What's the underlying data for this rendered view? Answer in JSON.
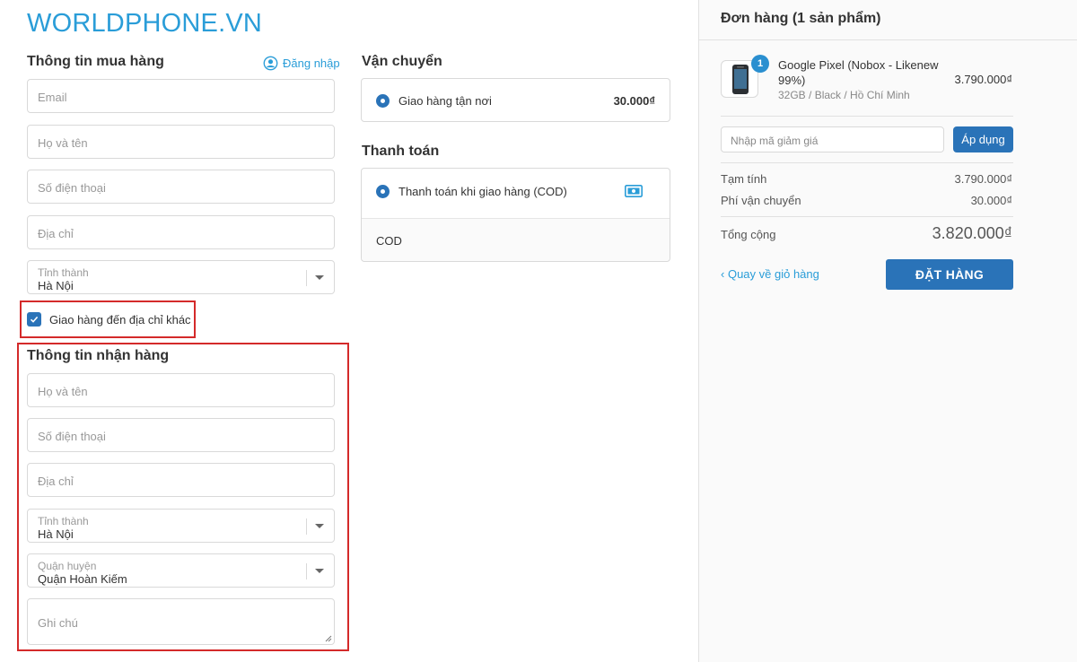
{
  "brand": {
    "logo_text": "WORLDPHONE.VN"
  },
  "buyer": {
    "title": "Thông tin mua hàng",
    "login_label": "Đăng nhập",
    "email_placeholder": "Email",
    "name_placeholder": "Họ và tên",
    "phone_placeholder": "Số điện thoại",
    "address_placeholder": "Địa chỉ",
    "province_label": "Tỉnh thành",
    "province_value": "Hà Nội"
  },
  "ship_other": {
    "label": "Giao hàng đến địa chỉ khác",
    "checked": true
  },
  "receiver": {
    "title": "Thông tin nhận hàng",
    "name_placeholder": "Họ và tên",
    "phone_placeholder": "Số điện thoại",
    "address_placeholder": "Địa chỉ",
    "province_label": "Tỉnh thành",
    "province_value": "Hà Nội",
    "district_label": "Quận huyện",
    "district_value": "Quận Hoàn Kiếm",
    "note_placeholder": "Ghi chú"
  },
  "shipping": {
    "title": "Vận chuyển",
    "option_label": "Giao hàng tận nơi",
    "option_price": "30.000₫"
  },
  "payment": {
    "title": "Thanh toán",
    "option_label": "Thanh toán khi giao hàng (COD)",
    "detail": "COD"
  },
  "order": {
    "title": "Đơn hàng (1 sản phẩm)",
    "item": {
      "quantity": "1",
      "name": "Google Pixel (Nobox - Likenew 99%)",
      "variant": "32GB / Black / Hồ Chí Minh",
      "price": "3.790.000₫"
    },
    "discount_placeholder": "Nhập mã giảm giá",
    "apply_label": "Áp dụng",
    "subtotal_label": "Tạm tính",
    "subtotal_value": "3.790.000₫",
    "shipping_label": "Phí vận chuyển",
    "shipping_value": "30.000₫",
    "total_label": "Tổng cộng",
    "total_value": "3.820.000₫",
    "back_label": "Quay về giỏ hàng",
    "place_order_label": "ĐẶT HÀNG"
  },
  "colors": {
    "accent": "#2a73b8",
    "link": "#2a9dd8",
    "highlight": "#d42a2a"
  }
}
